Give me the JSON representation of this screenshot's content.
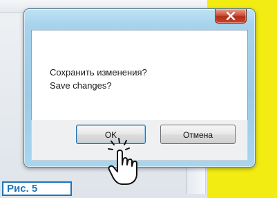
{
  "dialog": {
    "message_line1": "Сохранить изменения?",
    "message_line2": "Save changes?",
    "ok_label": "OK",
    "cancel_label": "Отмена",
    "close_icon": "close-x-icon"
  },
  "caption": {
    "text": "Рис. 5"
  },
  "cursor": {
    "icon": "hand-pointer-click-icon"
  },
  "colors": {
    "yellow_panel": "#f2ec12",
    "dialog_frame": "#a7d3ec",
    "close_button": "#c9472f",
    "caption_blue": "#1b75bb",
    "ok_focus_border": "#2b6fa8"
  }
}
